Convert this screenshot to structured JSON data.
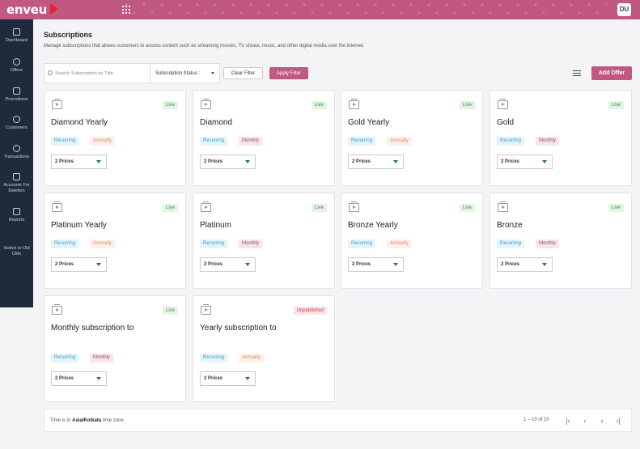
{
  "header": {
    "logo": "enveu",
    "avatar_initials": "DU",
    "brand_color": "#c0587f"
  },
  "sidebar": {
    "items": [
      {
        "label": "Dashboard"
      },
      {
        "label": "Offers"
      },
      {
        "label": "Promotions"
      },
      {
        "label": "Customers"
      },
      {
        "label": "Transactions"
      },
      {
        "label": "Accounts For Deletion"
      },
      {
        "label": "Reports"
      },
      {
        "label": "Switch to Old CMs"
      }
    ]
  },
  "page": {
    "title": "Subscriptions",
    "description": "Manage subscriptions that allows customers to access content such as streaming movies, TV shows, music, and other digital media over the internet."
  },
  "filters": {
    "search_placeholder": "Search Subscription by Title",
    "status_label": "Subscription Status :",
    "clear_label": "Clear Filter",
    "apply_label": "Apply Filter",
    "add_label": "Add Offer"
  },
  "cards": [
    {
      "title": "Diamond Yearly",
      "status": "Live",
      "type": "Recurring",
      "period": "Annually",
      "prices": "2 Prices"
    },
    {
      "title": "Diamond",
      "status": "Live",
      "type": "Recurring",
      "period": "Monthly",
      "prices": "2 Prices"
    },
    {
      "title": "Gold Yearly",
      "status": "Live",
      "type": "Recurring",
      "period": "Annually",
      "prices": "2 Prices"
    },
    {
      "title": "Gold",
      "status": "Live",
      "type": "Recurring",
      "period": "Monthly",
      "prices": "2 Prices"
    },
    {
      "title": "Platinum Yearly",
      "status": "Live",
      "type": "Recurring",
      "period": "Annually",
      "prices": "2 Prices"
    },
    {
      "title": "Platinum",
      "status": "Live",
      "type": "Recurring",
      "period": "Monthly",
      "prices": "2 Prices"
    },
    {
      "title": "Bronze Yearly",
      "status": "Live",
      "type": "Recurring",
      "period": "Annually",
      "prices": "2 Prices"
    },
    {
      "title": "Bronze",
      "status": "Live",
      "type": "Recurring",
      "period": "Monthly",
      "prices": "2 Prices"
    },
    {
      "title": "Monthly subscription to",
      "status": "Live",
      "type": "Recurring",
      "period": "Monthly",
      "prices": "2 Prices"
    },
    {
      "title": "Yearly subscription to",
      "status": "Unpublished",
      "type": "Recurring",
      "period": "Annually",
      "prices": "2 Prices"
    }
  ],
  "footer": {
    "tz_prefix": "Time is in",
    "tz_value": "Asia/Kolkata",
    "tz_suffix": "time zone",
    "range": "1 – 10 of 10",
    "first_icon": "first-page-icon",
    "prev_icon": "prev-page-icon",
    "next_icon": "next-page-icon",
    "last_icon": "last-page-icon"
  }
}
